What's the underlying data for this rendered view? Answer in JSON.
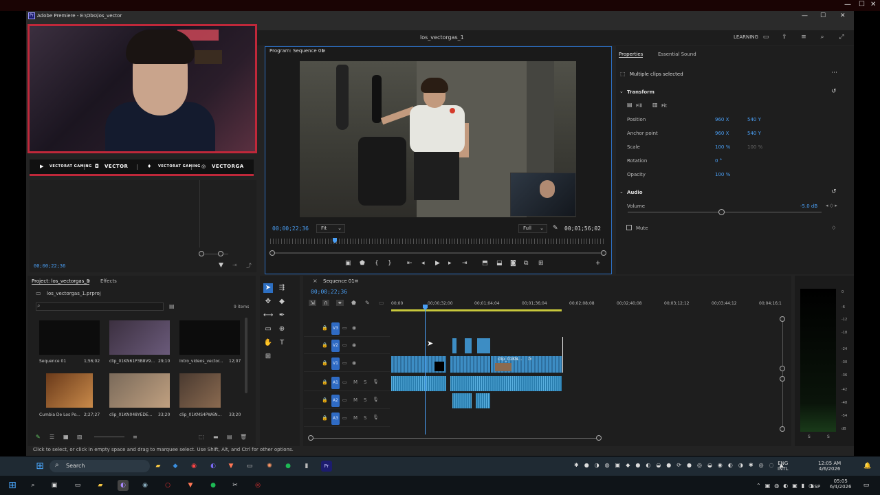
{
  "window": {
    "title": "Adobe Premiere - E:\\Obs\\los_vector",
    "sequence_name": "los_vectorgas_1",
    "workspace": "LEARNING"
  },
  "overlay": {
    "socials": [
      "VECTORAT GAMING",
      "VECTOR",
      "VECTORAT GAMING",
      "VECTORGA"
    ]
  },
  "source": {
    "timecode": "00;00;22;36"
  },
  "program": {
    "title": "Program: Sequence 01",
    "current_time": "00;00;22;36",
    "fit": "Fit",
    "quality": "Full",
    "duration": "00;01;56;02"
  },
  "properties": {
    "tabs": [
      "Properties",
      "Essential Sound"
    ],
    "selection": "Multiple clips selected",
    "transform_label": "Transform",
    "fill": "Fill",
    "fit": "Fit",
    "position_label": "Position",
    "position_x": "960 X",
    "position_y": "540 Y",
    "anchor_label": "Anchor point",
    "anchor_x": "960 X",
    "anchor_y": "540 Y",
    "scale_label": "Scale",
    "scale_value": "100 %",
    "scale_value2": "100 %",
    "rotation_label": "Rotation",
    "rotation_value": "0 °",
    "opacity_label": "Opacity",
    "opacity_value": "100 %",
    "audio_label": "Audio",
    "volume_label": "Volume",
    "volume_value": "-5.0 dB",
    "mute_label": "Mute"
  },
  "project": {
    "tab": "Project: los_vectorgas_1",
    "effects_tab": "Effects",
    "file": "los_vectorgas_1.prproj",
    "count": "9 items",
    "items": [
      {
        "name": "Sequence 01",
        "duration": "1;56;02"
      },
      {
        "name": "clip_01KN61P3B8V9...",
        "duration": "29;10"
      },
      {
        "name": "Intro_videos_vector...",
        "duration": "12;07"
      },
      {
        "name": "Cumbia De Los Po...",
        "duration": "2;27;27"
      },
      {
        "name": "clip_01KN048YEDE...",
        "duration": "33;20"
      },
      {
        "name": "clip_01KMS4PW6N...",
        "duration": "33;20"
      }
    ]
  },
  "timeline": {
    "title": "Sequence 01",
    "timecode": "00;00;22;36",
    "ruler": [
      "00;00",
      "00;00;32;00",
      "00;01;04;04",
      "00;01;36;04",
      "00;02;08;08",
      "00;02;40;08",
      "00;03;12;12",
      "00;03;44;12",
      "00;04;16;1"
    ],
    "tracks": [
      "V3",
      "V2",
      "V1",
      "A1",
      "A2",
      "A3"
    ],
    "clip_label": "clip_01KN..."
  },
  "meter": {
    "labels": [
      "0",
      "-6",
      "-12",
      "-18",
      "-24",
      "-30",
      "-36",
      "-42",
      "-48",
      "-54",
      "dB"
    ],
    "channels": [
      "S",
      "S"
    ]
  },
  "status_text": "Click to select, or click in empty space and drag to marquee select. Use Shift, Alt, and Ctrl for other options.",
  "taskbar": {
    "search": "Search",
    "lang": "ENG",
    "lang2": "INTL",
    "time": "12:05 AM",
    "date": "4/6/2026",
    "time2": "05:05",
    "date2": "6/4/2026",
    "lang3": "ESP"
  }
}
